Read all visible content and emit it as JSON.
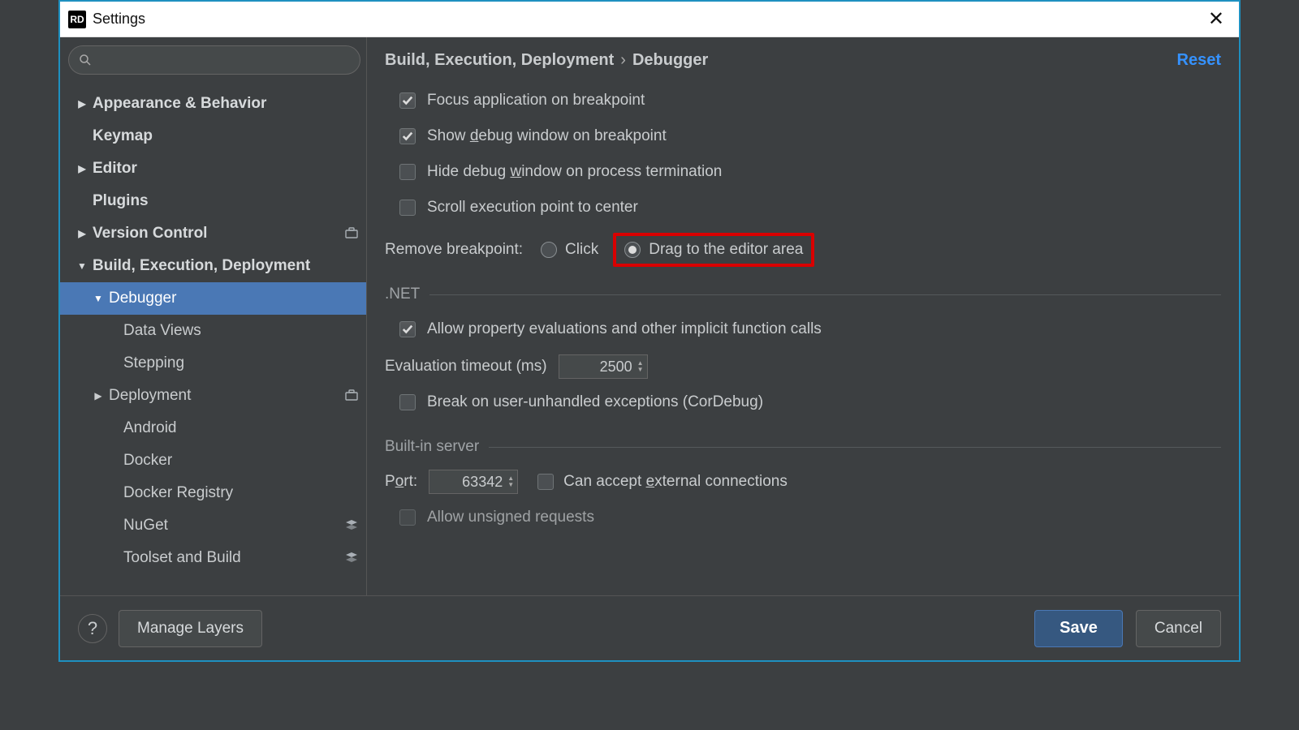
{
  "app": {
    "icon_text": "RD",
    "title": "Settings"
  },
  "search": {
    "placeholder": ""
  },
  "tree": {
    "items": [
      {
        "label": "Appearance & Behavior",
        "depth": 1,
        "arrow": "▶",
        "bold": true
      },
      {
        "label": "Keymap",
        "depth": 1,
        "arrow": "",
        "bold": true
      },
      {
        "label": "Editor",
        "depth": 1,
        "arrow": "▶",
        "bold": true
      },
      {
        "label": "Plugins",
        "depth": 1,
        "arrow": "",
        "bold": true
      },
      {
        "label": "Version Control",
        "depth": 1,
        "arrow": "▶",
        "bold": true,
        "badge": "briefcase"
      },
      {
        "label": "Build, Execution, Deployment",
        "depth": 1,
        "arrow": "▼",
        "bold": true
      },
      {
        "label": "Debugger",
        "depth": 2,
        "arrow": "▼",
        "bold": false,
        "selected": true
      },
      {
        "label": "Data Views",
        "depth": 3,
        "arrow": "",
        "bold": false
      },
      {
        "label": "Stepping",
        "depth": 3,
        "arrow": "",
        "bold": false
      },
      {
        "label": "Deployment",
        "depth": 2,
        "arrow": "▶",
        "bold": false,
        "badge": "briefcase"
      },
      {
        "label": "Android",
        "depth": 3,
        "arrow": "",
        "bold": false
      },
      {
        "label": "Docker",
        "depth": 3,
        "arrow": "",
        "bold": false
      },
      {
        "label": "Docker Registry",
        "depth": 3,
        "arrow": "",
        "bold": false
      },
      {
        "label": "NuGet",
        "depth": 3,
        "arrow": "",
        "bold": false,
        "badge": "layers"
      },
      {
        "label": "Toolset and Build",
        "depth": 3,
        "arrow": "",
        "bold": false,
        "badge": "layers"
      }
    ]
  },
  "header": {
    "crumb1": "Build, Execution, Deployment",
    "sep": "›",
    "crumb2": "Debugger",
    "reset": "Reset"
  },
  "options": {
    "focus_app": {
      "label": "Focus application on breakpoint",
      "checked": true
    },
    "show_debug": {
      "pre": "Show ",
      "u": "d",
      "post": "ebug window on breakpoint",
      "checked": true
    },
    "hide_debug": {
      "pre": "Hide debug ",
      "u": "w",
      "post": "indow on process termination",
      "checked": false
    },
    "scroll_exec": {
      "label": "Scroll execution point to center",
      "checked": false
    },
    "remove_bp": {
      "label": "Remove breakpoint:",
      "click": "Click",
      "drag": "Drag to the editor area",
      "selected": "drag"
    }
  },
  "sections": {
    "net": ".NET",
    "builtin": "Built-in server"
  },
  "net": {
    "allow_prop": {
      "label": "Allow property evaluations and other implicit function calls",
      "checked": true
    },
    "eval_timeout": {
      "label": "Evaluation timeout (ms)",
      "value": "2500"
    },
    "break_unhandled": {
      "label": "Break on user-unhandled exceptions (CorDebug)",
      "checked": false
    }
  },
  "server": {
    "port": {
      "pre": "P",
      "u": "o",
      "post": "rt:",
      "value": "63342"
    },
    "accept_ext": {
      "pre": "Can accept ",
      "u": "e",
      "post": "xternal connections",
      "checked": false
    },
    "allow_unsigned": {
      "label": "Allow unsigned requests",
      "checked": false
    }
  },
  "footer": {
    "help": "?",
    "manage": "Manage Layers",
    "save": "Save",
    "cancel": "Cancel"
  }
}
